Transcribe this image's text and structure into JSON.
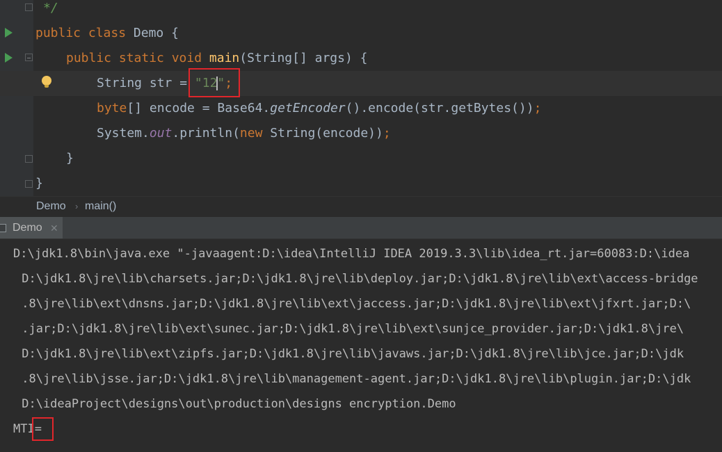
{
  "editor": {
    "lines": [
      {
        "comment": "*/"
      },
      {
        "kw1": "public class ",
        "name": "Demo",
        "rest": " {"
      },
      {
        "kw1": "public static void ",
        "fn": "main",
        "rest": "(String[] args) {"
      },
      {
        "a": "String str = ",
        "s1": "\"12",
        "s2": "\"",
        "semi": ";"
      },
      {
        "kw1": "byte",
        "a": "[] encode = Base64.",
        "it": "getEncoder",
        "b": "().encode(str.getBytes())",
        "semi": ";"
      },
      {
        "a": "System.",
        "fld": "out",
        "b": ".println(",
        "kw2": "new ",
        "c": "String(encode))",
        "semi": ";"
      },
      {
        "brace": "}"
      },
      {
        "brace": "}"
      }
    ]
  },
  "breadcrumb": {
    "class_name": "Demo",
    "separator": "›",
    "method": "main()"
  },
  "run_tab": {
    "label": "Demo",
    "close": "✕"
  },
  "console": {
    "lines": [
      "D:\\jdk1.8\\bin\\java.exe \"-javaagent:D:\\idea\\IntelliJ IDEA 2019.3.3\\lib\\idea_rt.jar=60083:D:\\idea",
      " D:\\jdk1.8\\jre\\lib\\charsets.jar;D:\\jdk1.8\\jre\\lib\\deploy.jar;D:\\jdk1.8\\jre\\lib\\ext\\access-bridge",
      " .8\\jre\\lib\\ext\\dnsns.jar;D:\\jdk1.8\\jre\\lib\\ext\\jaccess.jar;D:\\jdk1.8\\jre\\lib\\ext\\jfxrt.jar;D:\\",
      " .jar;D:\\jdk1.8\\jre\\lib\\ext\\sunec.jar;D:\\jdk1.8\\jre\\lib\\ext\\sunjce_provider.jar;D:\\jdk1.8\\jre\\",
      " D:\\jdk1.8\\jre\\lib\\ext\\zipfs.jar;D:\\jdk1.8\\jre\\lib\\javaws.jar;D:\\jdk1.8\\jre\\lib\\jce.jar;D:\\jdk",
      " .8\\jre\\lib\\jsse.jar;D:\\jdk1.8\\jre\\lib\\management-agent.jar;D:\\jdk1.8\\jre\\lib\\plugin.jar;D:\\jdk",
      " D:\\ideaProject\\designs\\out\\production\\designs encryption.Demo",
      "MTI="
    ]
  },
  "colors": {
    "highlight": "#e1262b",
    "keyword": "#cc7832",
    "string": "#6a8759",
    "function": "#ffc66d",
    "field": "#9876aa"
  }
}
